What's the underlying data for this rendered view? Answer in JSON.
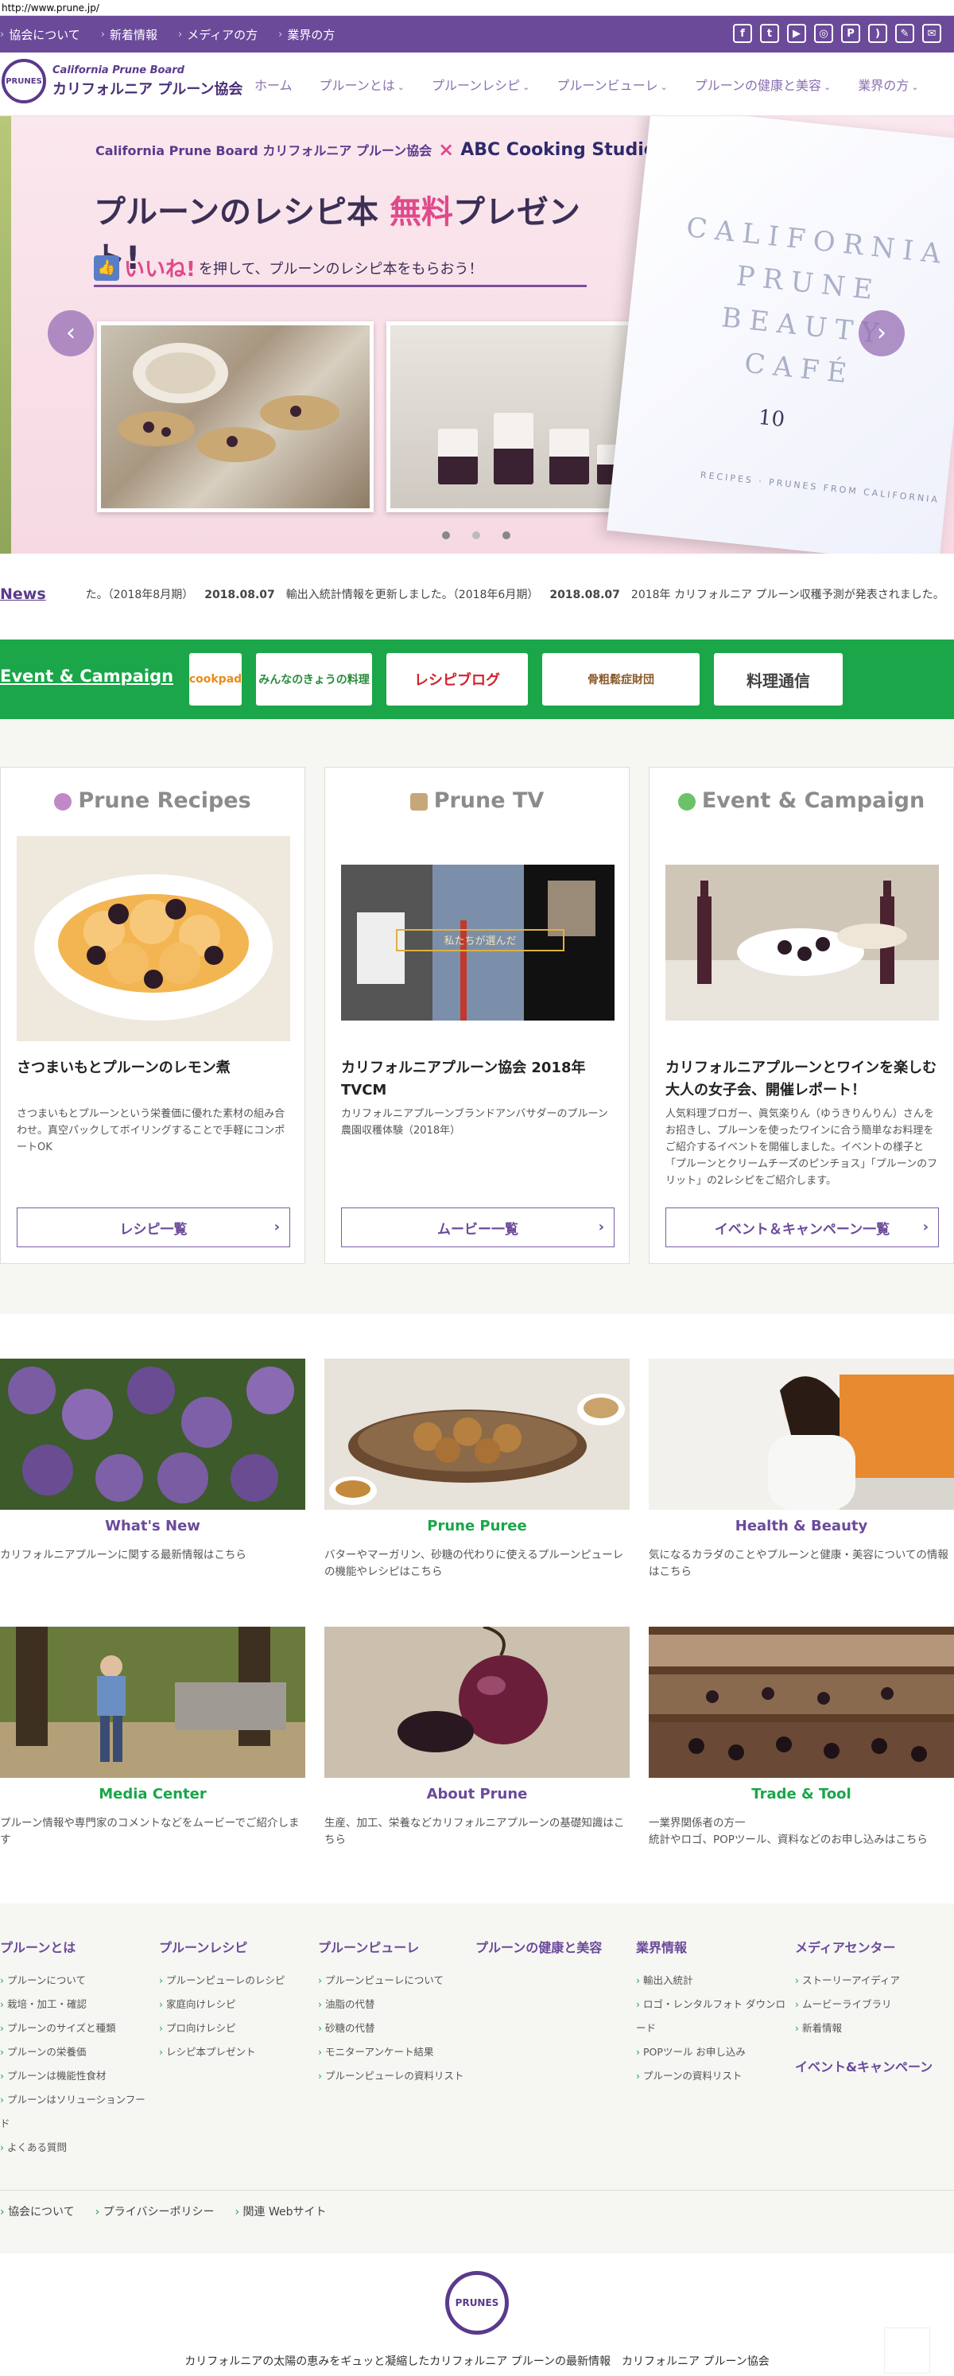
{
  "browser": {
    "url": "http://www.prune.jp/"
  },
  "topnav": [
    "協会について",
    "新着情報",
    "メディアの方",
    "業界の方"
  ],
  "social": [
    {
      "icon": "facebook-icon",
      "glyph": "f"
    },
    {
      "icon": "twitter-icon",
      "glyph": "t"
    },
    {
      "icon": "youtube-icon",
      "glyph": "▶"
    },
    {
      "icon": "instagram-icon",
      "glyph": "◎"
    },
    {
      "icon": "pinterest-icon",
      "glyph": "P"
    },
    {
      "icon": "rss-icon",
      "glyph": ")"
    },
    {
      "icon": "pencil-icon",
      "glyph": "✎"
    },
    {
      "icon": "mail-icon",
      "glyph": "✉"
    }
  ],
  "logo": {
    "en": "California Prune Board",
    "jp": "カリフォルニア プルーン協会",
    "badge": "PRUNES"
  },
  "mainnav": [
    "ホーム",
    "プルーンとは",
    "プルーンレシピ",
    "プルーンビューレ",
    "プルーンの健康と美容",
    "業界の方"
  ],
  "hero": {
    "brand1": "California Prune Board カリフォルニア プルーン協会",
    "cross": "×",
    "brand2": "ABC Cooking Studio",
    "title_a": "プルーンのレシピ本 ",
    "title_free": "無料",
    "title_b": "プレゼント!",
    "like": "いいね!",
    "sub": "を押して、プルーンのレシピ本をもらおう！",
    "book_title": "CALIFORNIA PRUNE BEAUTY CAFÉ",
    "book_num": "10",
    "book_sub": "RECIPES · PRUNES FROM CALIFORNIA"
  },
  "news": {
    "label": "News",
    "ticker": [
      {
        "date": "",
        "text": "た。（2018年8月期）"
      },
      {
        "date": "2018.08.07",
        "text": "輸出入統計情報を更新しました。（2018年6月期）"
      },
      {
        "date": "2018.08.07",
        "text": "2018年 カリフォルニア プルーン収穫予測が発表されました。"
      },
      {
        "date": "2018",
        "text": ""
      }
    ]
  },
  "events": {
    "label": "Event & Campaign",
    "partners": [
      {
        "name": "cookpad"
      },
      {
        "name": "みんなのきょうの料理"
      },
      {
        "name": "レシピブログ"
      },
      {
        "name": "骨粗鬆症財団"
      },
      {
        "name": "料理通信"
      }
    ]
  },
  "cards": [
    {
      "heading": "Prune Recipes",
      "title": "さつまいもとプルーンのレモン煮",
      "desc": "さつまいもとプルーンという栄養価に優れた素材の組み合わせ。真空パックしてボイリングすることで手軽にコンポートOK",
      "button": "レシピ一覧"
    },
    {
      "heading": "Prune TV",
      "title": "カリフォルニアプルーン協会 2018年TVCM",
      "desc": "カリフォルニアプルーンブランドアンバサダーのプルーン農園収穫体験（2018年）",
      "button": "ムービー一覧",
      "overlay": "私たちが選んだ"
    },
    {
      "heading": "Event & Campaign",
      "title": "カリフォルニアプルーンとワインを楽しむ大人の女子会、開催レポート！",
      "desc": "人気料理ブロガー、眞気楽りん（ゆうきりんりん）さんをお招きし、プルーンを使ったワインに合う簡単なお料理をご紹介するイベントを開催しました。イベントの様子と「プルーンとクリームチーズのピンチョス」「プルーンのフリット」の2レシピをご紹介します。",
      "button": "イベント＆キャンペーン一覧"
    }
  ],
  "tiles": [
    {
      "title": "What's New",
      "color": "#6b4a9a",
      "desc": "カリフォルニアプルーンに関する最新情報はこちら"
    },
    {
      "title": "Prune Puree",
      "color": "#1aa649",
      "desc": "バターやマーガリン、砂糖の代わりに使えるプルーンピューレの機能やレシピはこちら"
    },
    {
      "title": "Health & Beauty",
      "color": "#6b4a9a",
      "desc": "気になるカラダのことやプルーンと健康・美容についての情報はこちら"
    },
    {
      "title": "Media Center",
      "color": "#1aa649",
      "desc": "プルーン情報や専門家のコメントなどをムービーでご紹介します"
    },
    {
      "title": "About Prune",
      "color": "#6b4a9a",
      "desc": "生産、加工、栄養などカリフォルニアプルーンの基礎知識はこちら"
    },
    {
      "title": "Trade & Tool",
      "color": "#1aa649",
      "desc": "一業界関係者の方一\n統計やロゴ、POPツール、資料などのお申し込みはこちら"
    }
  ],
  "sitemap": [
    {
      "heading": "プルーンとは",
      "items": [
        "プルーンについて",
        "栽培・加工・確認",
        "プルーンのサイズと種類",
        "プルーンの栄養価",
        "プルーンは機能性食材",
        "プルーンはソリューションフード",
        "よくある質問"
      ]
    },
    {
      "heading": "プルーンレシピ",
      "items": [
        "プルーンピューレのレシピ",
        "家庭向けレシピ",
        "プロ向けレシピ",
        "レシピ本プレゼント"
      ]
    },
    {
      "heading": "プルーンピューレ",
      "items": [
        "プルーンピューレについて",
        "油脂の代替",
        "砂糖の代替",
        "モニターアンケート結果",
        "プルーンピューレの資料リスト"
      ]
    },
    {
      "heading": "プルーンの健康と美容",
      "items": []
    },
    {
      "heading": "業界情報",
      "items": [
        "輸出入統計",
        "ロゴ・レンタルフォト ダウンロード",
        "POPツール お申し込み",
        "プルーンの資料リスト"
      ]
    },
    {
      "heading": "メディアセンター",
      "items": [
        "ストーリーアイディア",
        "ムービーライブラリ",
        "新着情報"
      ],
      "extra": "イベント&キャンペーン"
    }
  ],
  "footer": {
    "links": [
      "協会について",
      "プライバシーポリシー",
      "関連 Webサイト"
    ],
    "tagline": "カリフォルニアの太陽の恵みをギュッと凝縮したカリフォルニア プルーンの最新情報　カリフォルニア プルーン協会",
    "logo_text": "PRUNES"
  },
  "colors": {
    "brand": "#6b4a9a",
    "green": "#1aa649",
    "pink": "#e0498a"
  }
}
